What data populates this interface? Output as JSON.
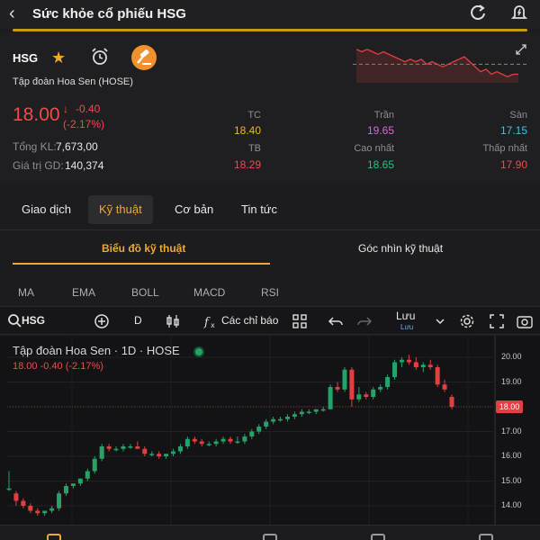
{
  "header": {
    "title": "Sức khỏe cổ phiếu HSG",
    "back_icon": "chevron-left-icon",
    "refresh_icon": "refresh-icon",
    "alert_icon": "bell-icon"
  },
  "stock": {
    "symbol": "HSG",
    "company": "Tập đoàn Hoa Sen (HOSE)",
    "price": "18.00",
    "change": "-0.40",
    "change_pct": "(-2.17%)",
    "total_volume_label": "Tổng KL:",
    "total_volume": "7,673,00",
    "value_label": "Giá trị GD:",
    "value": "140,374",
    "tc_label": "TC",
    "tc": "18.40",
    "tran_label": "Trần",
    "tran": "19.65",
    "san_label": "Sàn",
    "san": "17.15",
    "tb_label": "TB",
    "tb": "18.29",
    "cao_label": "Cao nhất",
    "cao": "18.65",
    "thap_label": "Thấp nhất",
    "thap": "17.90",
    "colors": {
      "down": "#ee4b4b",
      "up": "#26c281",
      "ref": "#f0b429",
      "ceil": "#d46bd4",
      "floor": "#3fc1e6"
    }
  },
  "tabs": [
    "Giao dịch",
    "Kỹ thuật",
    "Cơ bản",
    "Tin tức"
  ],
  "subtabs": [
    "Biểu đồ kỹ thuật",
    "Góc nhìn kỹ thuật"
  ],
  "indicators": [
    "MA",
    "EMA",
    "BOLL",
    "MACD",
    "RSI"
  ],
  "toolbar": {
    "symbol": "HSG",
    "interval": "D",
    "indicators_label": "Các chỉ báo",
    "save_label": "Lưu",
    "save_sub": "Lưu"
  },
  "chart": {
    "title": "Tập đoàn Hoa Sen · 1D · HOSE",
    "ohlc": "18.00  -0.40  (-2.17%)",
    "current_price_tag": "18.00"
  },
  "chart_data": {
    "type": "candlestick",
    "y_ticks": [
      "20.00",
      "19.00",
      "18.00",
      "17.00",
      "16.00",
      "15.00",
      "14.00"
    ],
    "ylim": [
      13.6,
      20.4
    ],
    "candles": [
      [
        14.7,
        15.4,
        14.6,
        14.7
      ],
      [
        14.5,
        14.6,
        14.0,
        14.2
      ],
      [
        14.2,
        14.3,
        13.9,
        14.0
      ],
      [
        14.0,
        14.1,
        13.7,
        13.8
      ],
      [
        13.8,
        13.9,
        13.6,
        13.7
      ],
      [
        13.7,
        13.8,
        13.6,
        13.8
      ],
      [
        13.8,
        14.0,
        13.7,
        13.9
      ],
      [
        13.9,
        14.6,
        13.8,
        14.5
      ],
      [
        14.5,
        14.9,
        14.4,
        14.8
      ],
      [
        14.8,
        14.9,
        14.7,
        14.9
      ],
      [
        14.9,
        15.1,
        14.8,
        15.1
      ],
      [
        15.1,
        15.5,
        15.0,
        15.4
      ],
      [
        15.4,
        16.0,
        15.3,
        15.9
      ],
      [
        15.9,
        16.5,
        15.8,
        16.4
      ],
      [
        16.4,
        16.5,
        16.2,
        16.3
      ],
      [
        16.3,
        16.4,
        16.2,
        16.3
      ],
      [
        16.3,
        16.5,
        16.2,
        16.4
      ],
      [
        16.4,
        16.5,
        16.3,
        16.4
      ],
      [
        16.4,
        16.6,
        16.3,
        16.3
      ],
      [
        16.3,
        16.4,
        16.0,
        16.1
      ],
      [
        16.1,
        16.2,
        16.0,
        16.1
      ],
      [
        16.1,
        16.2,
        15.9,
        16.0
      ],
      [
        16.0,
        16.1,
        15.9,
        16.1
      ],
      [
        16.1,
        16.3,
        16.0,
        16.2
      ],
      [
        16.2,
        16.5,
        16.1,
        16.4
      ],
      [
        16.4,
        16.8,
        16.3,
        16.7
      ],
      [
        16.7,
        16.8,
        16.5,
        16.6
      ],
      [
        16.6,
        16.7,
        16.4,
        16.5
      ],
      [
        16.5,
        16.6,
        16.4,
        16.5
      ],
      [
        16.5,
        16.7,
        16.4,
        16.6
      ],
      [
        16.6,
        16.8,
        16.5,
        16.7
      ],
      [
        16.7,
        16.8,
        16.5,
        16.6
      ],
      [
        16.6,
        16.8,
        16.5,
        16.6
      ],
      [
        16.6,
        16.9,
        16.5,
        16.8
      ],
      [
        16.8,
        17.1,
        16.7,
        17.0
      ],
      [
        17.0,
        17.3,
        16.9,
        17.2
      ],
      [
        17.2,
        17.5,
        17.1,
        17.4
      ],
      [
        17.4,
        17.6,
        17.3,
        17.5
      ],
      [
        17.5,
        17.6,
        17.4,
        17.5
      ],
      [
        17.5,
        17.7,
        17.4,
        17.6
      ],
      [
        17.6,
        17.8,
        17.5,
        17.7
      ],
      [
        17.7,
        17.9,
        17.6,
        17.8
      ],
      [
        17.8,
        17.9,
        17.7,
        17.8
      ],
      [
        17.8,
        17.9,
        17.7,
        17.9
      ],
      [
        17.9,
        18.0,
        17.8,
        17.9
      ],
      [
        17.9,
        18.9,
        17.9,
        18.8
      ],
      [
        18.8,
        19.0,
        18.6,
        18.7
      ],
      [
        18.7,
        19.6,
        18.6,
        19.5
      ],
      [
        19.5,
        19.6,
        18.0,
        18.3
      ],
      [
        18.3,
        18.8,
        18.2,
        18.5
      ],
      [
        18.5,
        18.6,
        18.3,
        18.4
      ],
      [
        18.4,
        18.8,
        18.3,
        18.7
      ],
      [
        18.7,
        18.9,
        18.6,
        18.8
      ],
      [
        18.8,
        19.3,
        18.7,
        19.2
      ],
      [
        19.2,
        19.9,
        19.1,
        19.8
      ],
      [
        19.8,
        20.0,
        19.6,
        19.9
      ],
      [
        19.9,
        20.1,
        19.7,
        19.8
      ],
      [
        19.8,
        20.0,
        19.5,
        19.6
      ],
      [
        19.6,
        19.8,
        19.4,
        19.7
      ],
      [
        19.7,
        19.9,
        19.5,
        19.6
      ],
      [
        19.6,
        19.7,
        18.8,
        18.9
      ],
      [
        18.9,
        19.1,
        18.6,
        18.7
      ],
      [
        18.4,
        18.5,
        17.9,
        18.0
      ]
    ]
  },
  "sparkline": {
    "type": "line",
    "reference": 18.4,
    "values": [
      19.0,
      18.9,
      19.0,
      18.9,
      18.8,
      18.9,
      18.8,
      18.7,
      18.6,
      18.5,
      18.6,
      18.5,
      18.6,
      18.4,
      18.5,
      18.4,
      18.3,
      18.4,
      18.5,
      18.6,
      18.7,
      18.5,
      18.3,
      18.1,
      18.2,
      18.0,
      18.1,
      18.0,
      17.9,
      18.0,
      18.0
    ]
  },
  "bottom_nav": [
    "home-icon",
    "chart-icon",
    "wallet-icon",
    "chat-icon"
  ]
}
